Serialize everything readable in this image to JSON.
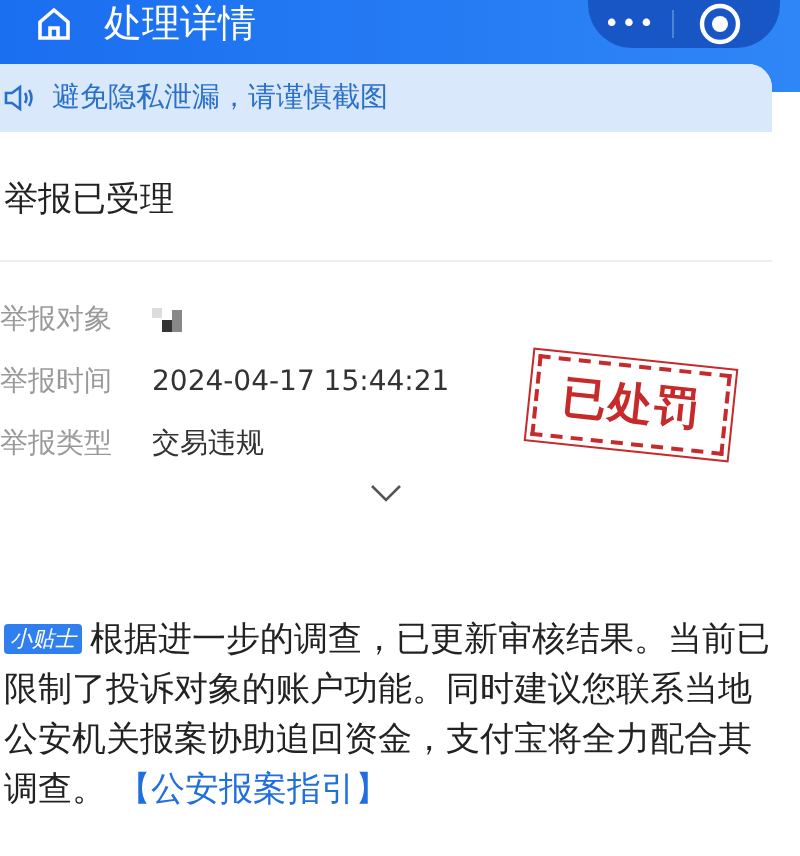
{
  "header": {
    "title": "处理详情",
    "menu": "•••"
  },
  "notice": {
    "text": "避免隐私泄漏，请谨慎截图"
  },
  "status_title": "举报已受理",
  "details": [
    {
      "label": "举报对象",
      "kind": "redacted"
    },
    {
      "label": "举报时间",
      "kind": "text",
      "value": "2024-04-17 15:44:21"
    },
    {
      "label": "举报类型",
      "kind": "text",
      "value": "交易违规"
    }
  ],
  "stamp": "已处罚",
  "tip": {
    "tag": "小贴士",
    "text": "根据进一步的调查，已更新审核结果。当前已限制了投诉对象的账户功能。同时建议您联系当地公安机关报案协助追回资金，支付宝将全力配合其调查。",
    "link": "【公安报案指引】"
  }
}
